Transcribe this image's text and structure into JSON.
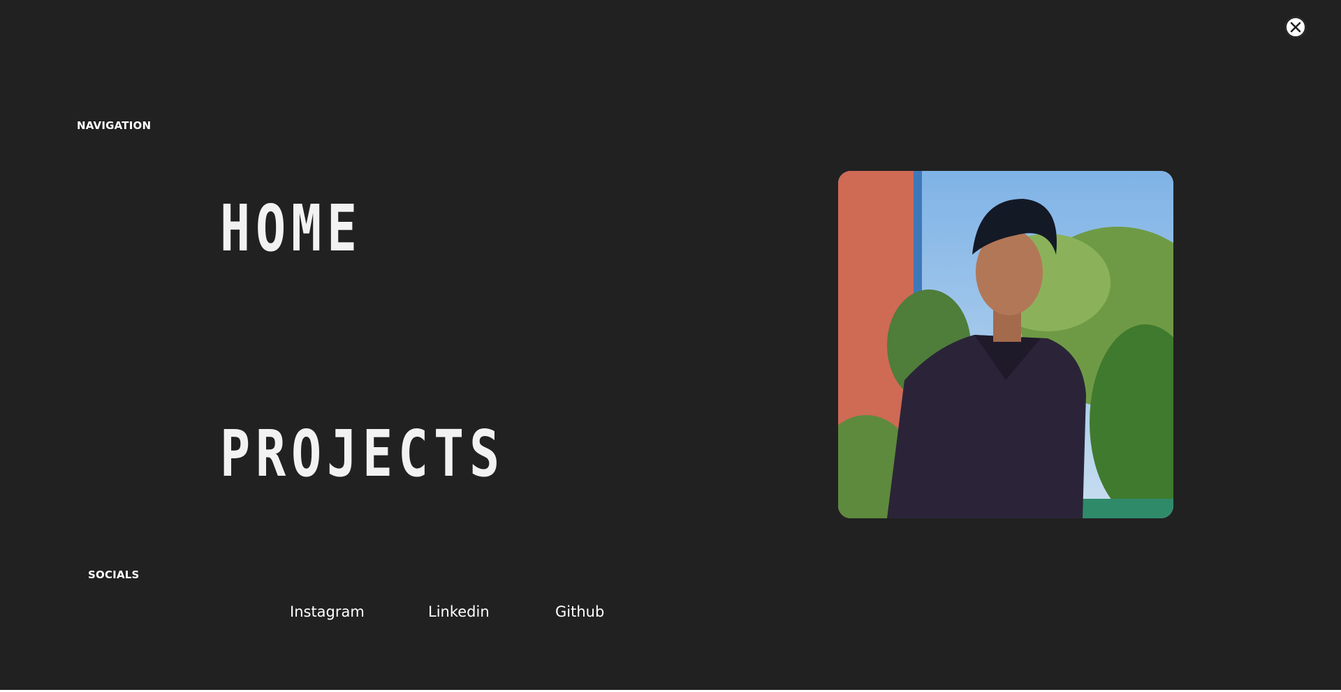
{
  "close_button": {
    "icon": "close-icon"
  },
  "navigation": {
    "label": "NAVIGATION",
    "links": [
      {
        "label": "HOME"
      },
      {
        "label": "PROJECTS"
      }
    ]
  },
  "socials": {
    "label": "SOCIALS",
    "links": [
      {
        "label": "Instagram"
      },
      {
        "label": "Linkedin"
      },
      {
        "label": "Github"
      }
    ]
  },
  "colors": {
    "background": "#212121",
    "text": "#ffffff"
  }
}
